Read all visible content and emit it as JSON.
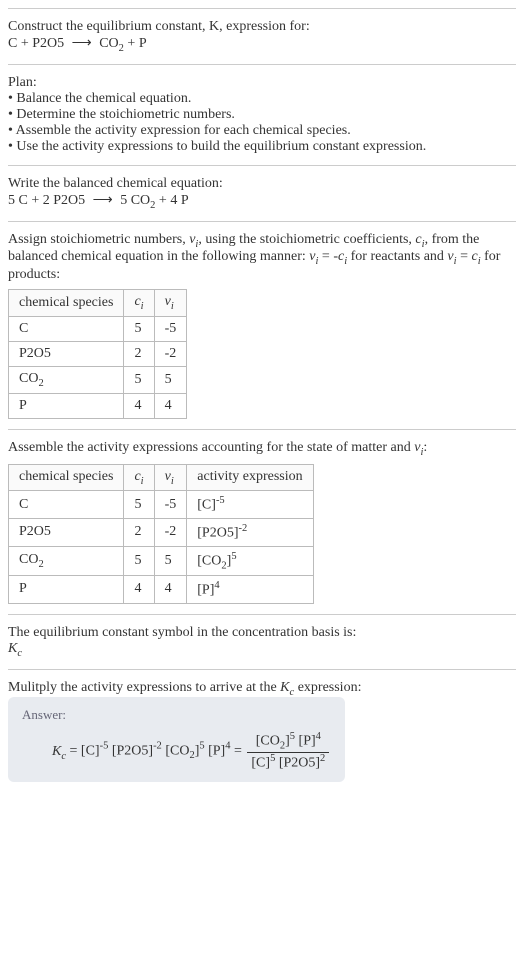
{
  "intro": {
    "line1": "Construct the equilibrium constant, K, expression for:"
  },
  "plan": {
    "heading": "Plan:",
    "items": [
      "Balance the chemical equation.",
      "Determine the stoichiometric numbers.",
      "Assemble the activity expression for each chemical species.",
      "Use the activity expressions to build the equilibrium constant expression."
    ]
  },
  "balanced": {
    "heading": "Write the balanced chemical equation:"
  },
  "assign": {
    "text1": "Assign stoichiometric numbers, ",
    "text2": ", using the stoichiometric coefficients, ",
    "text3": ", from the balanced chemical equation in the following manner: ",
    "text4": " for reactants and ",
    "text5": " for products:"
  },
  "table1": {
    "headers": [
      "chemical species"
    ],
    "rows": [
      {
        "species": "C",
        "c": "5",
        "v": "-5"
      },
      {
        "species_html": "P2O5",
        "c": "2",
        "v": "-2"
      },
      {
        "species_html": "CO2",
        "c": "5",
        "v": "5"
      },
      {
        "species": "P",
        "c": "4",
        "v": "4"
      }
    ]
  },
  "assemble": {
    "text": "Assemble the activity expressions accounting for the state of matter and "
  },
  "table2": {
    "headers_extra": "activity expression",
    "rows": [
      {
        "species": "C",
        "c": "5",
        "v": "-5",
        "expr_base": "[C]",
        "expr_exp": "-5"
      },
      {
        "species": "P2O5",
        "c": "2",
        "v": "-2",
        "expr_base": "[P2O5]",
        "expr_exp": "-2"
      },
      {
        "species": "CO2",
        "c": "5",
        "v": "5",
        "expr_base_html": "CO2",
        "expr_exp": "5"
      },
      {
        "species": "P",
        "c": "4",
        "v": "4",
        "expr_base": "[P]",
        "expr_exp": "4"
      }
    ]
  },
  "symbol": {
    "text": "The equilibrium constant symbol in the concentration basis is:"
  },
  "multiply": {
    "text": "Mulitply the activity expressions to arrive at the ",
    "text2": " expression:"
  },
  "answer": {
    "label": "Answer:"
  },
  "chart_data": {
    "type": "table",
    "title": "Stoichiometric numbers and activity expressions",
    "tables": [
      {
        "columns": [
          "chemical species",
          "c_i",
          "v_i"
        ],
        "rows": [
          [
            "C",
            5,
            -5
          ],
          [
            "P2O5",
            2,
            -2
          ],
          [
            "CO2",
            5,
            5
          ],
          [
            "P",
            4,
            4
          ]
        ]
      },
      {
        "columns": [
          "chemical species",
          "c_i",
          "v_i",
          "activity expression"
        ],
        "rows": [
          [
            "C",
            5,
            -5,
            "[C]^-5"
          ],
          [
            "P2O5",
            2,
            -2,
            "[P2O5]^-2"
          ],
          [
            "CO2",
            5,
            5,
            "[CO2]^5"
          ],
          [
            "P",
            4,
            4,
            "[P]^4"
          ]
        ]
      }
    ],
    "unbalanced_equation": "C + P2O5 -> CO2 + P",
    "balanced_equation": "5 C + 2 P2O5 -> 5 CO2 + 4 P",
    "equilibrium_constant": "K_c = [C]^-5 [P2O5]^-2 [CO2]^5 [P]^4 = ([CO2]^5 [P]^4) / ([C]^5 [P2O5]^2)"
  }
}
